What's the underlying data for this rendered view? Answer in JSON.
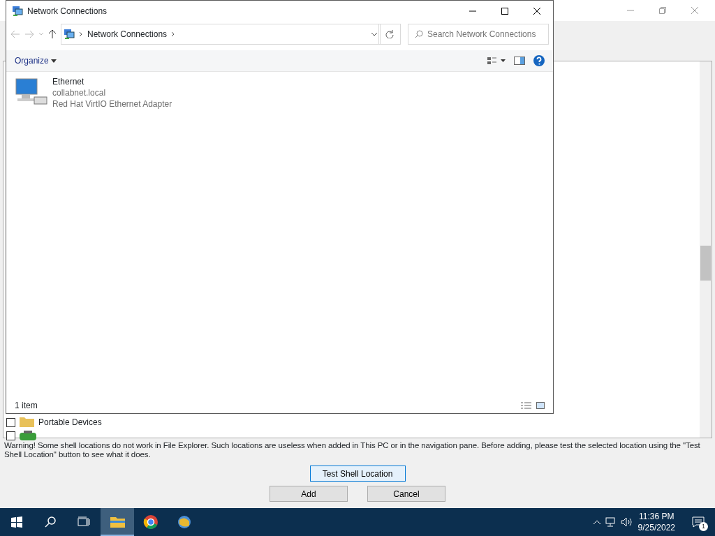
{
  "background_dialog": {
    "list_items": [
      {
        "kind": "folder",
        "label": "Portable Devices",
        "checked": false
      },
      {
        "kind": "power",
        "checked": false
      }
    ],
    "warning": "Warning! Some shell locations do not work in File Explorer. Such locations are useless when added in This PC or in the navigation pane. Before adding, please test the selected location using the \"Test Shell Location\" button to see what it does.",
    "test_button": "Test Shell Location",
    "buttons": [
      "Add",
      "Cancel"
    ]
  },
  "explorer": {
    "title": "Network Connections",
    "breadcrumb": "Network Connections",
    "search": {
      "placeholder": "Search Network Connections"
    },
    "toolbar": {
      "organize": "Organize"
    },
    "items": [
      {
        "name": "Ethernet",
        "domain": "collabnet.local",
        "adapter": "Red Hat VirtIO Ethernet Adapter"
      }
    ],
    "status_bar": "1 item"
  },
  "taskbar": {
    "apps": [
      {
        "kind": "explorer",
        "selected": true
      },
      {
        "kind": "chrome",
        "selected": false
      },
      {
        "kind": "globe",
        "selected": false
      }
    ],
    "time": "11:36 PM",
    "date": "9/25/2022",
    "notifications": "1"
  }
}
